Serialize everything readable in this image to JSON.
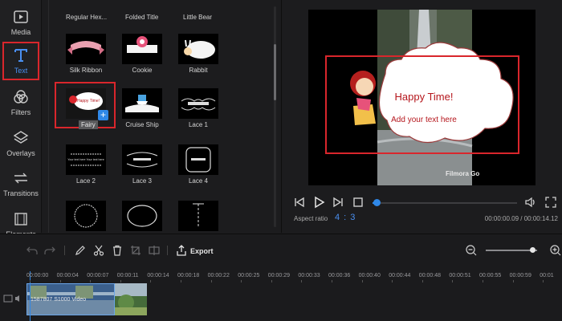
{
  "sidebar": {
    "items": [
      {
        "label": "Media",
        "icon": "media-icon"
      },
      {
        "label": "Text",
        "icon": "text-icon",
        "active": true
      },
      {
        "label": "Filters",
        "icon": "filters-icon"
      },
      {
        "label": "Overlays",
        "icon": "overlays-icon"
      },
      {
        "label": "Transitions",
        "icon": "transitions-icon"
      },
      {
        "label": "Elements",
        "icon": "elements-icon"
      }
    ]
  },
  "templates": {
    "header_row": [
      "Regular Hex...",
      "Folded Title",
      "Little Bear"
    ],
    "rows": [
      [
        "Silk Ribbon",
        "Cookie",
        "Rabbit"
      ],
      [
        "Fairy",
        "Cruise Ship",
        "Lace 1"
      ],
      [
        "Lace 2",
        "Lace 3",
        "Lace 4"
      ]
    ],
    "selected": "Fairy",
    "thumb_texts": {
      "fairy": "Happy Time!",
      "lace_2": "Your text here Your text here"
    }
  },
  "preview": {
    "title_text": "Happy Time!",
    "sub_text": "Add your text here",
    "watermark": "Filmora Go",
    "aspect_label": "Aspect ratio",
    "aspect_value": "4 : 3",
    "current_time": "00:00:00.09",
    "total_time": "00:00:14.12",
    "progress": 0.03
  },
  "toolbar": {
    "export_label": "Export",
    "zoom_level": 0.9
  },
  "timeline": {
    "ticks": [
      "00:00:00",
      "00:00:04",
      "00:00:07",
      "00:00:11",
      "00:00:14",
      "00:00:18",
      "00:00:22",
      "00:00:25",
      "00:00:29",
      "00:00:33",
      "00:00:36",
      "00:00:40",
      "00:00:44",
      "00:00:48",
      "00:00:51",
      "00:00:55",
      "00:00:59",
      "00:01"
    ],
    "clip_name": "1587807 S1000 Video"
  },
  "colors": {
    "accent": "#2f88e8",
    "highlight": "#d9262c",
    "cloud_text": "#b5161c"
  }
}
